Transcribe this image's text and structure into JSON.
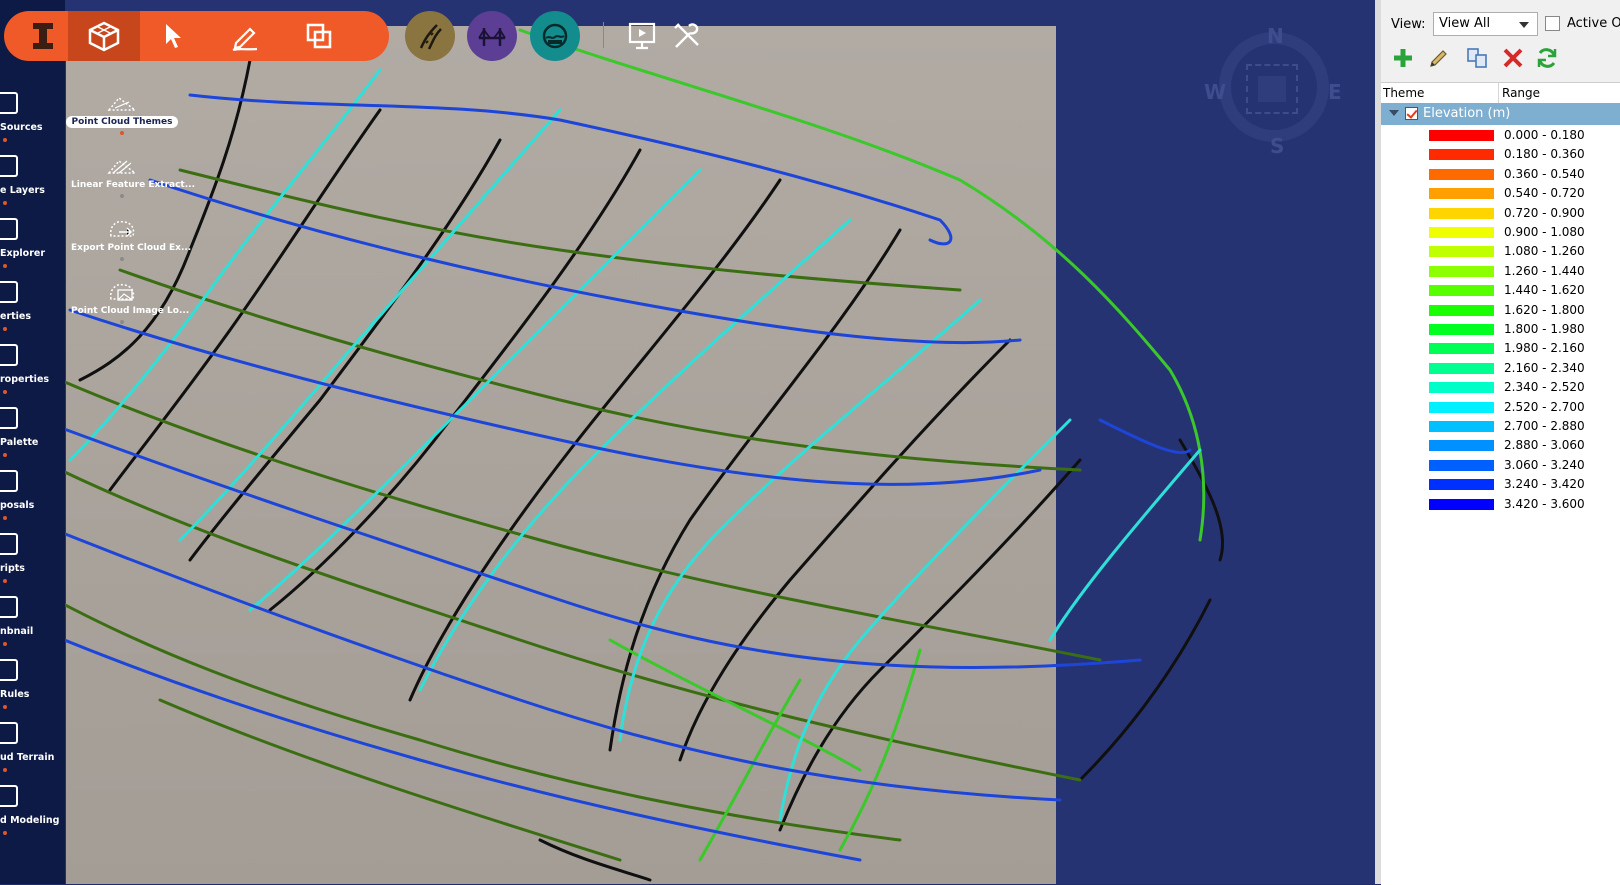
{
  "toolbar": {
    "buttons": [
      {
        "name": "infraworks-logo-icon"
      },
      {
        "name": "model-cube-icon"
      },
      {
        "name": "select-arrow-icon"
      },
      {
        "name": "sketch-pencil-icon"
      },
      {
        "name": "duplicate-layers-icon"
      }
    ],
    "circle_buttons": [
      {
        "name": "road-design-icon",
        "color": "#8a7440"
      },
      {
        "name": "bridge-design-icon",
        "color": "#5c3f94"
      },
      {
        "name": "drainage-design-icon",
        "color": "#138c8e"
      }
    ],
    "extra_buttons": [
      {
        "name": "presentation-icon"
      },
      {
        "name": "settings-tools-icon"
      }
    ]
  },
  "left_panel": {
    "items": [
      {
        "label": "Sources",
        "name": "sources"
      },
      {
        "label": "e Layers",
        "name": "surface-layers"
      },
      {
        "label": "Explorer",
        "name": "explorer"
      },
      {
        "label": "erties",
        "name": "properties"
      },
      {
        "label": "roperties",
        "name": "style-properties"
      },
      {
        "label": "Palette",
        "name": "palette"
      },
      {
        "label": "posals",
        "name": "proposals"
      },
      {
        "label": "ripts",
        "name": "scripts"
      },
      {
        "label": "nbnail",
        "name": "thumbnail"
      },
      {
        "label": "Rules",
        "name": "rules"
      },
      {
        "label": "ud Terrain",
        "name": "point-cloud-terrain"
      },
      {
        "label": "d Modeling",
        "name": "point-cloud-modeling"
      }
    ]
  },
  "tool_panel": {
    "items": [
      {
        "label": "Point Cloud Themes",
        "active": true
      },
      {
        "label": "Linear Feature Extract...",
        "active": false
      },
      {
        "label": "Export Point Cloud Ex...",
        "active": false
      },
      {
        "label": "Point Cloud Image Lo...",
        "active": false
      }
    ]
  },
  "compass": {
    "n": "N",
    "s": "S",
    "e": "E",
    "w": "W"
  },
  "theme_panel": {
    "view_label": "View:",
    "view_value": "View All",
    "active_only_label": "Active Onl",
    "columns": [
      "Theme",
      "Range"
    ],
    "group_label": "Elevation (m)",
    "legend": [
      {
        "range": "0.000 - 0.180",
        "color": "#ff0000"
      },
      {
        "range": "0.180 - 0.360",
        "color": "#ff2a00"
      },
      {
        "range": "0.360 - 0.540",
        "color": "#ff6a00"
      },
      {
        "range": "0.540 - 0.720",
        "color": "#ffa000"
      },
      {
        "range": "0.720 - 0.900",
        "color": "#ffd500"
      },
      {
        "range": "0.900 - 1.080",
        "color": "#f0ff00"
      },
      {
        "range": "1.080 - 1.260",
        "color": "#bfff00"
      },
      {
        "range": "1.260 - 1.440",
        "color": "#8cff00"
      },
      {
        "range": "1.440 - 1.620",
        "color": "#55ff00"
      },
      {
        "range": "1.620 - 1.800",
        "color": "#1aff00"
      },
      {
        "range": "1.800 - 1.980",
        "color": "#00ff20"
      },
      {
        "range": "1.980 - 2.160",
        "color": "#00ff55"
      },
      {
        "range": "2.160 - 2.340",
        "color": "#00ff90"
      },
      {
        "range": "2.340 - 2.520",
        "color": "#00ffc8"
      },
      {
        "range": "2.520 - 2.700",
        "color": "#00f0ff"
      },
      {
        "range": "2.700 - 2.880",
        "color": "#00c0ff"
      },
      {
        "range": "2.880 - 3.060",
        "color": "#0090ff"
      },
      {
        "range": "3.060 - 3.240",
        "color": "#0060ff"
      },
      {
        "range": "3.240 - 3.420",
        "color": "#0030ff"
      },
      {
        "range": "3.420 - 3.600",
        "color": "#0000ff"
      }
    ]
  }
}
